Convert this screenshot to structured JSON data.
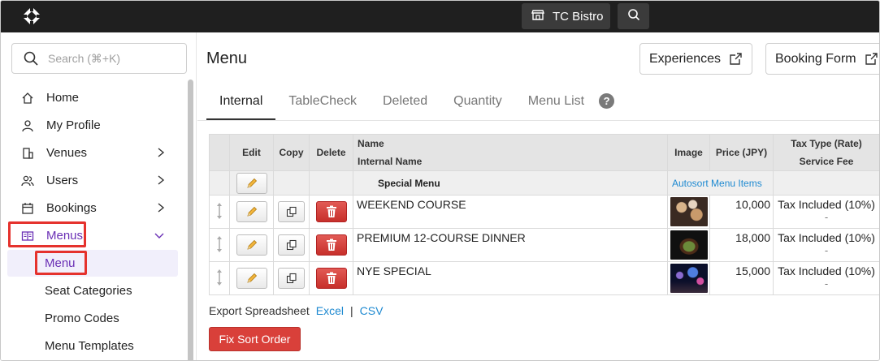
{
  "topbar": {
    "venue_name": "TC Bistro"
  },
  "sidebar": {
    "search_placeholder": "Search (⌘+K)",
    "items": [
      {
        "label": "Home",
        "icon": "home-icon"
      },
      {
        "label": "My Profile",
        "icon": "user-icon"
      },
      {
        "label": "Venues",
        "icon": "building-icon"
      },
      {
        "label": "Users",
        "icon": "users-icon"
      },
      {
        "label": "Bookings",
        "icon": "calendar-icon"
      },
      {
        "label": "Menus",
        "icon": "menu-book-icon"
      }
    ],
    "sub_items": [
      {
        "label": "Menu"
      },
      {
        "label": "Seat Categories"
      },
      {
        "label": "Promo Codes"
      },
      {
        "label": "Menu Templates"
      }
    ]
  },
  "main": {
    "title": "Menu",
    "buttons": {
      "experiences": "Experiences",
      "booking_form": "Booking Form"
    },
    "tabs": [
      "Internal",
      "TableCheck",
      "Deleted",
      "Quantity",
      "Menu List"
    ],
    "help": "?",
    "table": {
      "headers": {
        "edit": "Edit",
        "copy": "Copy",
        "delete": "Delete",
        "name": "Name",
        "internal_name": "Internal Name",
        "image": "Image",
        "price": "Price (JPY)",
        "tax_type": "Tax Type (Rate)",
        "service_fee": "Service Fee"
      },
      "section": {
        "name": "Special Menu",
        "autosort": "Autosort Menu Items"
      },
      "rows": [
        {
          "name": "WEEKEND COURSE",
          "price": "10,000",
          "tax": "Tax Included (10%)",
          "service_fee": "-"
        },
        {
          "name": "PREMIUM 12-COURSE DINNER",
          "price": "18,000",
          "tax": "Tax Included (10%)",
          "service_fee": "-"
        },
        {
          "name": "NYE SPECIAL",
          "price": "15,000",
          "tax": "Tax Included (10%)",
          "service_fee": "-"
        }
      ]
    },
    "export": {
      "label": "Export Spreadsheet",
      "excel": "Excel",
      "sep": "|",
      "csv": "CSV"
    },
    "fix_sort": "Fix Sort Order"
  },
  "colors": {
    "accent": "#6a2fb5",
    "danger": "#d9403a",
    "link": "#1f8ad1",
    "highlight": "#e5322d"
  }
}
